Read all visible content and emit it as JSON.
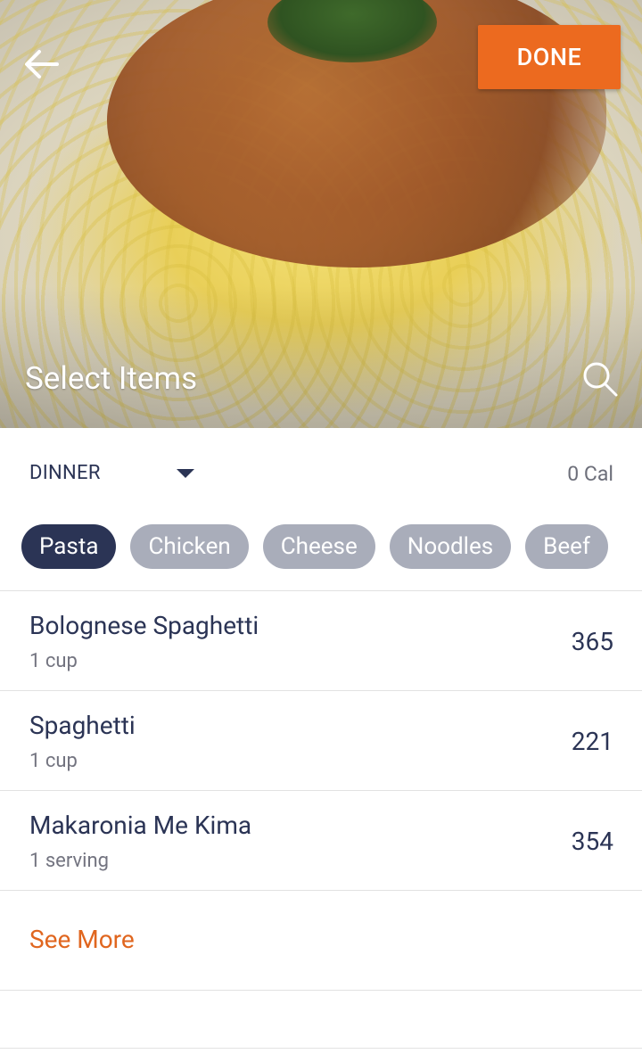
{
  "header": {
    "title": "Select Items",
    "done_label": "DONE",
    "back_icon": "arrow-left-icon",
    "search_icon": "search-icon"
  },
  "meal": {
    "selected": "DINNER",
    "total_calories": "0 Cal"
  },
  "categories": [
    {
      "label": "Pasta",
      "active": true
    },
    {
      "label": "Chicken",
      "active": false
    },
    {
      "label": "Cheese",
      "active": false
    },
    {
      "label": "Noodles",
      "active": false
    },
    {
      "label": "Beef",
      "active": false
    }
  ],
  "items": [
    {
      "name": "Bolognese Spaghetti",
      "portion": "1 cup",
      "calories": "365"
    },
    {
      "name": "Spaghetti",
      "portion": "1 cup",
      "calories": "221"
    },
    {
      "name": "Makaronia Me Kima",
      "portion": "1 serving",
      "calories": "354"
    }
  ],
  "see_more_label": "See More",
  "colors": {
    "accent": "#ec6a1f",
    "primary": "#2b3455",
    "chip_inactive": "#a9adba"
  }
}
